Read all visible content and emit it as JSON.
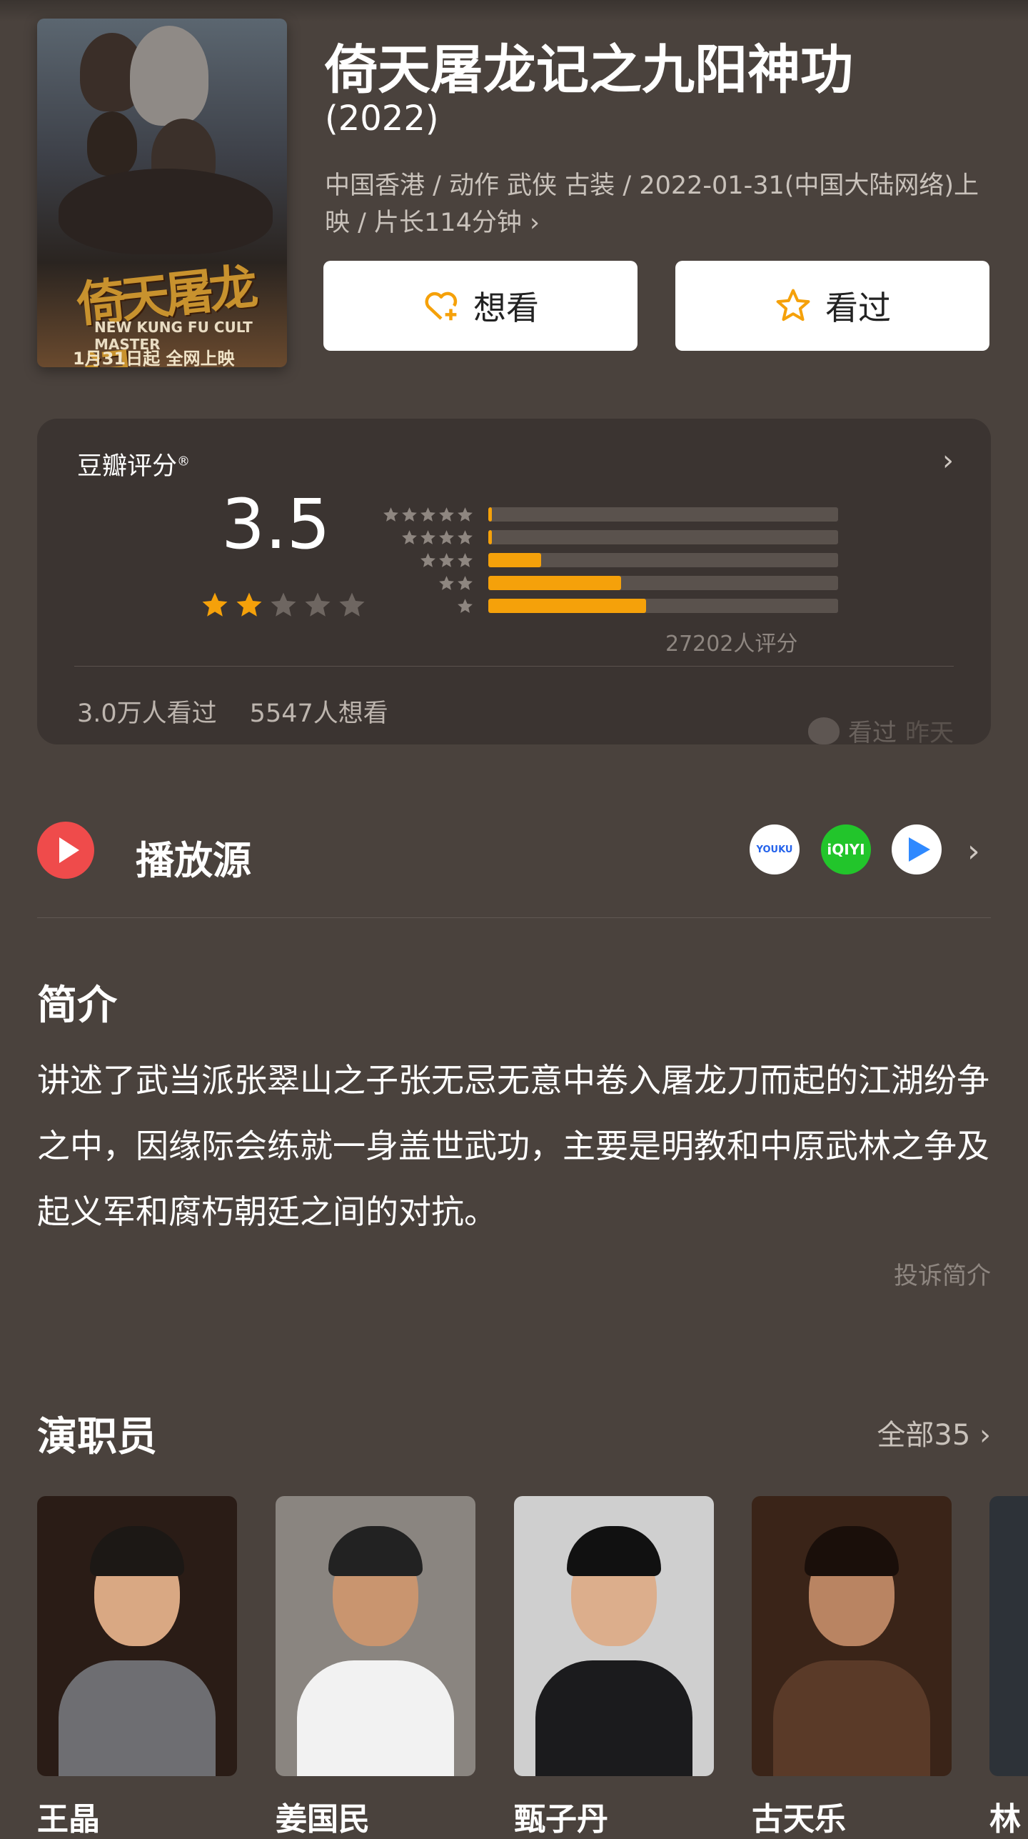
{
  "movie": {
    "title": "倚天屠龙记之九阳神功",
    "year": "(2022)",
    "meta": "中国香港 / 动作 武侠 古装 / 2022-01-31(中国大陆网络)上映 / 片长114分钟",
    "meta_chevron": "›",
    "want_label": "想看",
    "seen_label": "看过",
    "poster": {
      "title_art": "倚天屠龙记",
      "sub_art": "NEW KUNG FU CULT MASTER",
      "date_art": "1月31日起 全网上映"
    }
  },
  "rating": {
    "label": "豆瓣评分",
    "reg": "®",
    "arrow": "›",
    "score": "3.5",
    "stars_filled": 2,
    "stars_total": 5,
    "distribution_percent": [
      1,
      1,
      15,
      38,
      45
    ],
    "count_text": "27202人评分",
    "seen_count": "3.0万人看过",
    "want_count": "5547人想看",
    "seen_tag": "看过",
    "seen_when": "昨天"
  },
  "play": {
    "title": "播放源",
    "sources": [
      "YOUKU",
      "iQIYI",
      "腾讯视频"
    ],
    "chevron": "›"
  },
  "intro": {
    "heading": "简介",
    "text": "讲述了武当派张翠山之子张无忌无意中卷入屠龙刀而起的江湖纷争之中，因缘际会练就一身盖世武功，主要是明教和中原武林之争及起义军和腐朽朝廷之间的对抗。",
    "report": "投诉简介"
  },
  "cast": {
    "heading": "演职员",
    "all_label": "全部35",
    "chevron": "›",
    "people": [
      {
        "name": "王晶"
      },
      {
        "name": "姜国民"
      },
      {
        "name": "甄子丹"
      },
      {
        "name": "古天乐"
      },
      {
        "name": "林"
      }
    ]
  },
  "colors": {
    "background": "#4a423d",
    "card": "#3b3431",
    "accent_orange": "#f5a10a",
    "play_red": "#ef4b4b"
  }
}
